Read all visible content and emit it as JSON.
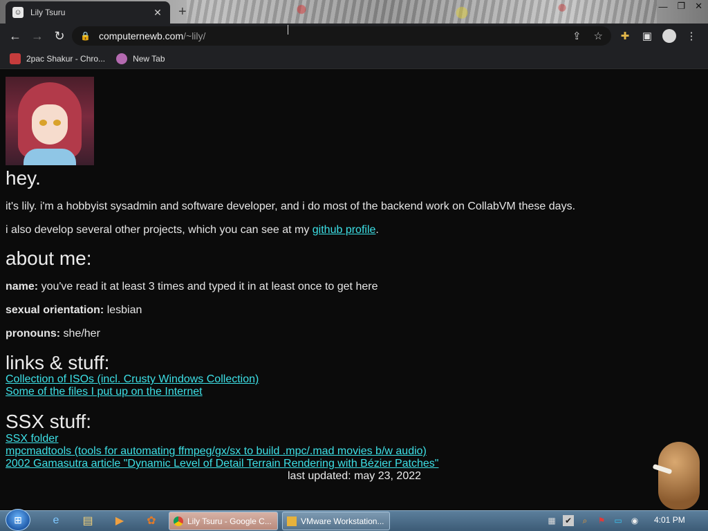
{
  "browser": {
    "tab_title": "Lily Tsuru",
    "url_host": "computernewb.com",
    "url_path": "/~lily/",
    "bookmarks": [
      {
        "label": "2pac Shakur - Chro...",
        "color": "#c63c3c"
      },
      {
        "label": "New Tab",
        "color": "#b46ab0"
      }
    ]
  },
  "page": {
    "heading_hey": "hey.",
    "intro_1": "it's lily. i'm a hobbyist sysadmin and software developer, and i do most of the backend work on CollabVM these days.",
    "intro_2_prefix": "i also develop several other projects, which you can see at my ",
    "intro_2_link": "github profile",
    "intro_2_suffix": ".",
    "heading_about": "about me:",
    "about": [
      {
        "key": "name:",
        "value": " you've read it at least 3 times and typed it in at least once to get here"
      },
      {
        "key": "sexual orientation:",
        "value": " lesbian"
      },
      {
        "key": "pronouns:",
        "value": " she/her"
      }
    ],
    "heading_links": "links & stuff:",
    "links": [
      "Collection of ISOs (incl. Crusty Windows Collection)",
      "Some of the files I put up on the Internet"
    ],
    "heading_ssx": "SSX stuff:",
    "ssx_links": [
      "SSX folder",
      "mpcmadtools (tools for automating ffmpeg/gx/sx to build .mpc/.mad movies b/w audio)",
      "2002 Gamasutra article \"Dynamic Level of Detail Terrain Rendering with Bézier Patches\""
    ],
    "last_updated": "last updated: may 23, 2022",
    "link_color": "#3de0e6"
  },
  "taskbar": {
    "tasks": [
      {
        "label": "Lily Tsuru - Google C..."
      },
      {
        "label": "VMware Workstation..."
      }
    ],
    "clock": "4:01 PM"
  }
}
